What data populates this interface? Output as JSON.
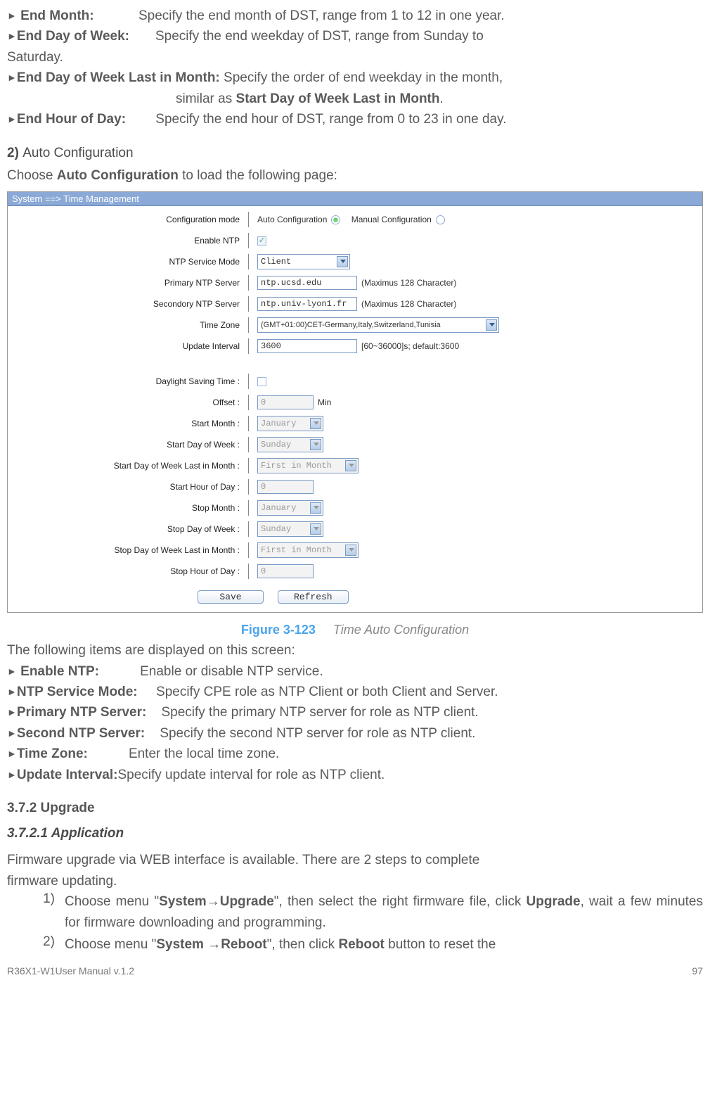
{
  "top": {
    "end_month_label": "End Month:",
    "end_month_desc": "Specify the end month of DST, range from 1 to 12 in one year.",
    "end_dow_label": "End Day of Week:",
    "end_dow_desc_part1": "Specify the end weekday of DST, range from Sunday to",
    "end_dow_desc_part2": "Saturday.",
    "end_dow_last_label": "End Day of Week Last in Month:",
    "end_dow_last_desc_part1": "Specify the order of end weekday in the month,",
    "end_dow_last_desc_part2a": "similar as ",
    "end_dow_last_desc_part2b": "Start Day of Week Last in Month",
    "end_dow_last_desc_part2c": ".",
    "end_hour_label": "End Hour of Day:",
    "end_hour_desc": "Specify the end hour of DST, range from 0 to 23 in one day."
  },
  "sec2": {
    "num": "2)",
    "title": "Auto Configuration",
    "intro_a": "Choose ",
    "intro_b": "Auto Configuration",
    "intro_c": " to load the following page:"
  },
  "shot": {
    "titlebar": "System ==> Time Management",
    "labels": {
      "conf_mode": "Configuration mode",
      "enable_ntp": "Enable NTP",
      "ntp_mode": "NTP Service Mode",
      "primary": "Primary NTP Server",
      "secondary": "Secondory NTP Server",
      "tz": "Time Zone",
      "upd": "Update Interval",
      "dst": "Daylight Saving Time :",
      "offset": "Offset :",
      "start_month": "Start Month :",
      "start_dow": "Start Day of Week :",
      "start_dow_last": "Start Day of Week Last in Month :",
      "start_hour": "Start Hour of Day :",
      "stop_month": "Stop Month :",
      "stop_dow": "Stop Day of Week :",
      "stop_dow_last": "Stop Day of Week Last in Month :",
      "stop_hour": "Stop Hour of Day :"
    },
    "values": {
      "auto": "Auto Configuration",
      "manual": "Manual Configuration",
      "ntp_mode": "Client",
      "primary": "ntp.ucsd.edu",
      "primary_note": "(Maximus 128 Character)",
      "secondary": "ntp.univ-lyon1.fr",
      "secondary_note": "(Maximus 128 Character)",
      "tz": "(GMT+01:00)CET-Germany,Italy,Switzerland,Tunisia",
      "upd": "3600",
      "upd_note": "[60~36000]s; default:3600",
      "offset": "0",
      "offset_unit": "Min",
      "month": "January",
      "dow": "Sunday",
      "order": "First in Month",
      "hour": "0"
    },
    "buttons": {
      "save": "Save",
      "refresh": "Refresh"
    }
  },
  "caption": {
    "fig": "Figure 3-123",
    "text": "Time Auto Configuration"
  },
  "below": {
    "intro": "The following items are displayed on this screen:",
    "enable_ntp_label": "Enable NTP:",
    "enable_ntp_desc": "Enable or disable NTP service.",
    "ntp_mode_label": "NTP Service Mode:",
    "ntp_mode_desc": "Specify CPE role as NTP Client or both Client and Server.",
    "primary_label": "Primary NTP Server:",
    "primary_desc": "Specify the primary NTP server for role as NTP client.",
    "second_label": "Second NTP Server:",
    "second_desc": "Specify the second NTP server for role as NTP client.",
    "tz_label": "Time Zone:",
    "tz_desc": "Enter the local time zone.",
    "upd_label": "Update Interval:",
    "upd_desc": "Specify update interval for role as NTP client."
  },
  "upgrade": {
    "h": "3.7.2 Upgrade",
    "sub": "3.7.2.1  Application",
    "intro1": "Firmware upgrade via WEB interface is available. There are 2 steps to complete",
    "intro2": "firmware updating.",
    "step1_a": "Choose menu \"",
    "step1_b": "System",
    "step1_arrow": "→",
    "step1_c": "Upgrade",
    "step1_d": "\", then select the right firmware file, click ",
    "step1_e": "Upgrade",
    "step1_f": ", wait a few minutes for firmware downloading and programming.",
    "step2_a": "Choose menu \"",
    "step2_b": "System ",
    "step2_arrow": "→",
    "step2_c": "Reboot",
    "step2_d": "\", then click ",
    "step2_e": "Reboot",
    "step2_f": " button to reset the"
  },
  "footer": {
    "left": "R36X1-W1User Manual v.1.2",
    "right": "97"
  }
}
